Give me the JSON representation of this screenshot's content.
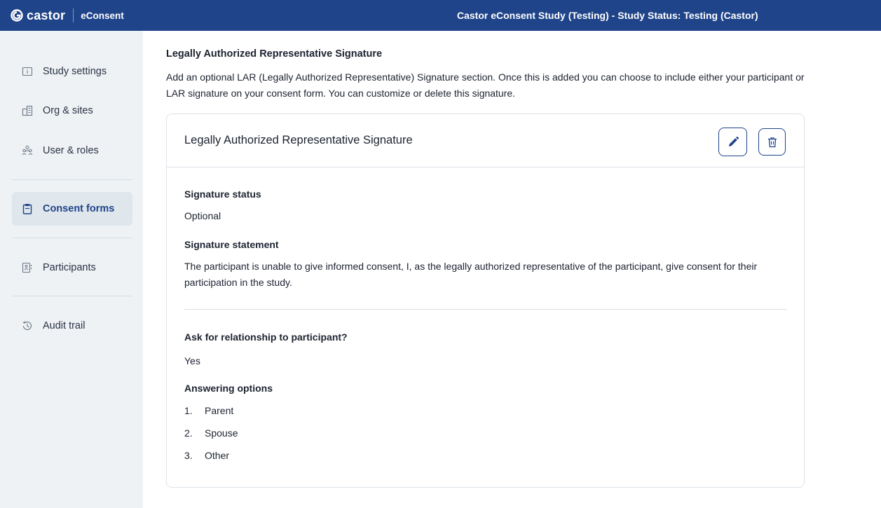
{
  "header": {
    "logo_text": "castor",
    "product": "eConsent",
    "study_status": "Castor eConsent Study (Testing)  - Study Status: Testing (Castor)"
  },
  "sidebar": {
    "items": [
      {
        "label": "Study settings",
        "icon": "info-square-icon"
      },
      {
        "label": "Org & sites",
        "icon": "building-icon"
      },
      {
        "label": "User & roles",
        "icon": "users-icon"
      },
      {
        "label": "Consent forms",
        "icon": "clipboard-icon",
        "active": true
      },
      {
        "label": "Participants",
        "icon": "participant-card-icon"
      },
      {
        "label": "Audit trail",
        "icon": "history-icon"
      }
    ]
  },
  "main": {
    "section_title": "Legally Authorized Representative Signature",
    "section_description": "Add an optional LAR (Legally Authorized Representative) Signature section. Once this is added you can choose to include either your participant or LAR signature on your consent form. You can customize or delete this signature.",
    "card": {
      "title": "Legally Authorized Representative Signature",
      "edit_icon": "pencil-icon",
      "delete_icon": "trash-icon",
      "status_label": "Signature status",
      "status_value": "Optional",
      "statement_label": "Signature statement",
      "statement_value": "The participant is unable to give informed consent, I, as the legally authorized representative of the participant, give consent for their participation in the study.",
      "relationship_label": "Ask for relationship to participant?",
      "relationship_value": "Yes",
      "options_label": "Answering options",
      "options": [
        {
          "num": "1.",
          "label": "Parent"
        },
        {
          "num": "2.",
          "label": "Spouse"
        },
        {
          "num": "3.",
          "label": "Other"
        }
      ]
    }
  },
  "colors": {
    "primary": "#1f4489",
    "sidebar_bg": "#eef2f5",
    "active_bg": "#dfe6ec"
  }
}
